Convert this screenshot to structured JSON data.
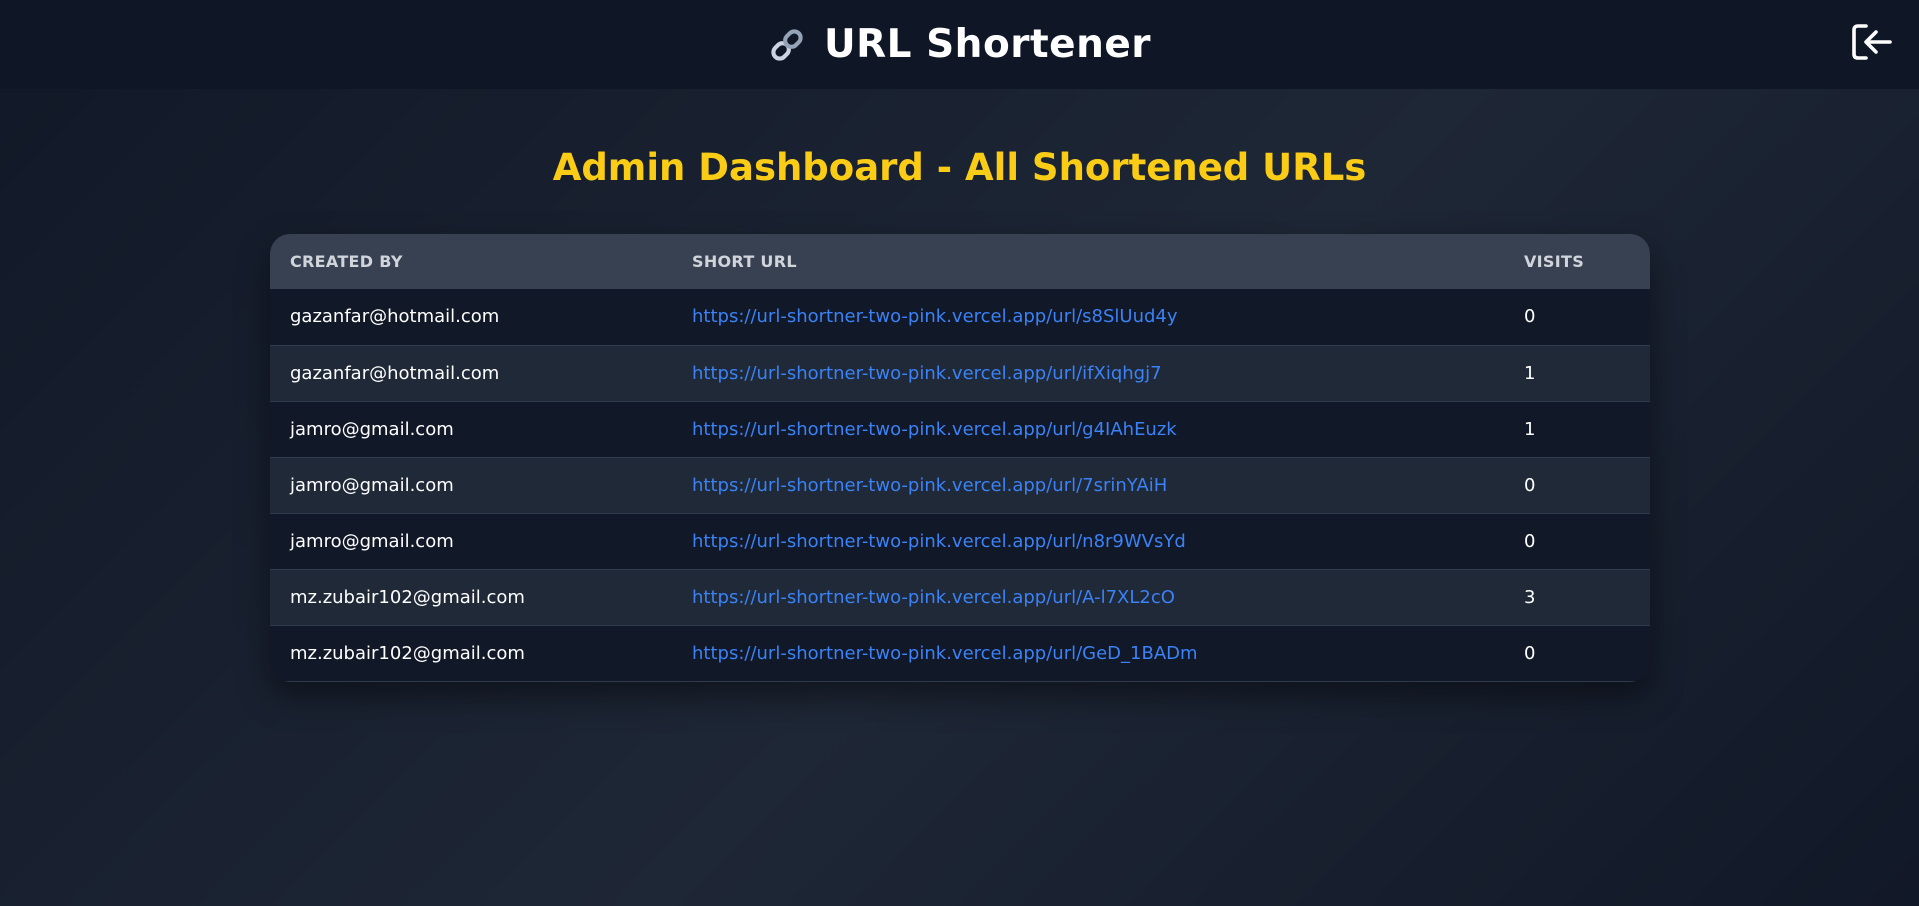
{
  "header": {
    "title": "URL Shortener",
    "brand_icon": "link-icon",
    "logout_icon": "logout-icon"
  },
  "page_title": "Admin Dashboard - All Shortened URLs",
  "table": {
    "columns": [
      "CREATED BY",
      "SHORT URL",
      "VISITS"
    ],
    "rows": [
      {
        "created_by": "gazanfar@hotmail.com",
        "short_url": "https://url-shortner-two-pink.vercel.app/url/s8SlUud4y",
        "visits": "0"
      },
      {
        "created_by": "gazanfar@hotmail.com",
        "short_url": "https://url-shortner-two-pink.vercel.app/url/ifXiqhgj7",
        "visits": "1"
      },
      {
        "created_by": "jamro@gmail.com",
        "short_url": "https://url-shortner-two-pink.vercel.app/url/g4IAhEuzk",
        "visits": "1"
      },
      {
        "created_by": "jamro@gmail.com",
        "short_url": "https://url-shortner-two-pink.vercel.app/url/7srinYAiH",
        "visits": "0"
      },
      {
        "created_by": "jamro@gmail.com",
        "short_url": "https://url-shortner-two-pink.vercel.app/url/n8r9WVsYd",
        "visits": "0"
      },
      {
        "created_by": "mz.zubair102@gmail.com",
        "short_url": "https://url-shortner-two-pink.vercel.app/url/A-l7XL2cO",
        "visits": "3"
      },
      {
        "created_by": "mz.zubair102@gmail.com",
        "short_url": "https://url-shortner-two-pink.vercel.app/url/GeD_1BADm",
        "visits": "0"
      }
    ]
  },
  "colors": {
    "accent": "#facc15",
    "link": "#3b82f6",
    "header_bg": "#0f1626",
    "table_header_bg": "#374151"
  }
}
